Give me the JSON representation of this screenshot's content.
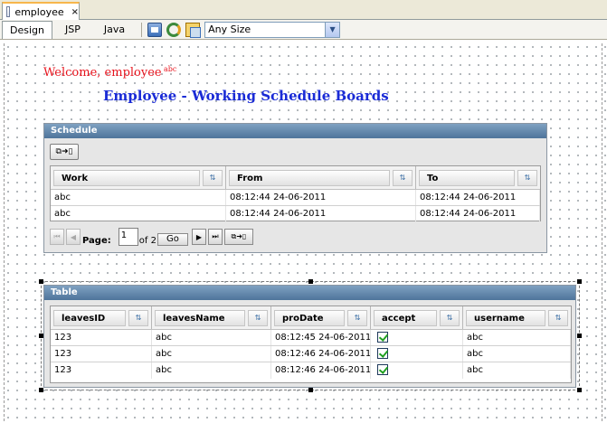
{
  "editor": {
    "file_tab": "employee",
    "close_glyph": "×",
    "view_tabs": [
      "Design",
      "JSP",
      "Java"
    ],
    "size_select": "Any Size"
  },
  "page": {
    "welcome": "Welcome, employee",
    "abc_tag": "abc",
    "heading": "Employee - Working Schedule Boards"
  },
  "schedule": {
    "title": "Schedule",
    "columns": [
      "Work",
      "From",
      "To"
    ],
    "rows": [
      [
        "abc",
        "08:12:44 24-06-2011",
        "08:12:44 24-06-2011"
      ],
      [
        "abc",
        "08:12:44 24-06-2011",
        "08:12:44 24-06-2011"
      ]
    ],
    "pager": {
      "page_label": "Page:",
      "current_page": "1",
      "of_text": "of 2",
      "go_label": "Go"
    }
  },
  "table": {
    "title": "Table",
    "columns": [
      "leavesID",
      "leavesName",
      "proDate",
      "accept",
      "username"
    ],
    "rows": [
      [
        "123",
        "abc",
        "08:12:45 24-06-2011",
        "",
        "abc"
      ],
      [
        "123",
        "abc",
        "08:12:46 24-06-2011",
        "",
        "abc"
      ],
      [
        "123",
        "abc",
        "08:12:46 24-06-2011",
        "",
        "abc"
      ]
    ],
    "accepted": [
      true,
      true,
      true
    ]
  },
  "glyphs": {
    "sort": "⇅",
    "first": "⏮",
    "prev": "◀",
    "next": "▶",
    "last": "⏭",
    "export": "⧉➜▯"
  },
  "colors": {
    "welcome": "#e8141e",
    "heading": "#1a2bd6",
    "panel_title": "#4e749b"
  }
}
